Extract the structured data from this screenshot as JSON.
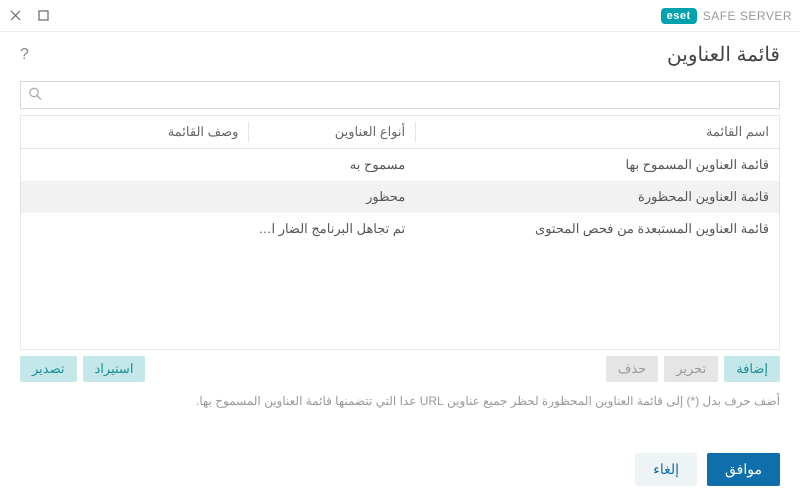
{
  "brand": {
    "logo": "eset",
    "product": "SAFE SERVER"
  },
  "page": {
    "title": "قائمة العناوين"
  },
  "search": {
    "placeholder": ""
  },
  "table": {
    "columns": {
      "name": "اسم القائمة",
      "type": "أنواع العناوين",
      "desc": "وصف القائمة"
    },
    "rows": [
      {
        "name": "قائمة العناوين المسموح بها",
        "type": "مسموح به",
        "desc": "",
        "selected": false
      },
      {
        "name": "قائمة العناوين المحظورة",
        "type": "محظور",
        "desc": "",
        "selected": true
      },
      {
        "name": "قائمة العناوين المستبعدة من فحص المحتوى",
        "type": "تم تجاهل البرنامج الضار الذ...",
        "desc": "",
        "selected": false
      }
    ]
  },
  "actions": {
    "add": "إضافة",
    "edit": "تحرير",
    "delete": "حذف",
    "import": "استيراد",
    "export": "تصدير"
  },
  "hint": "أضف حرف بدل (*) إلى قائمة العناوين المحظورة لحظر جميع عناوين URL عدا التي تتضمنها قائمة العناوين المسموح بها.",
  "footer": {
    "ok": "موافق",
    "cancel": "إلغاء"
  }
}
